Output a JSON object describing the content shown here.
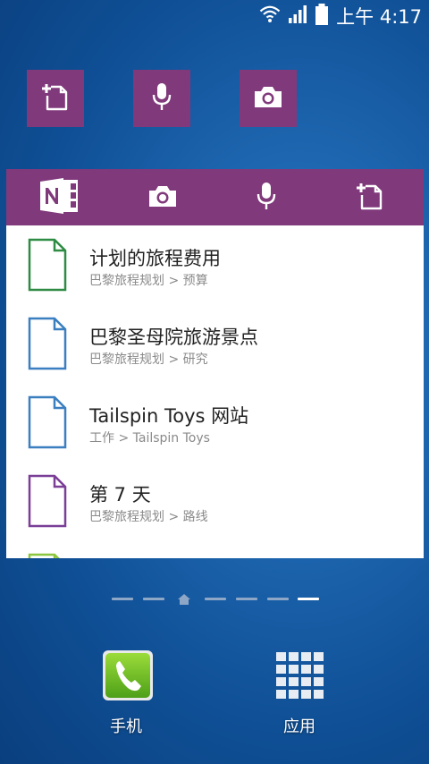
{
  "status": {
    "time": "上午 4:17"
  },
  "home_tiles": [
    {
      "icon": "new-page-icon"
    },
    {
      "icon": "mic-icon"
    },
    {
      "icon": "camera-icon"
    }
  ],
  "widget": {
    "toolbar_icons": [
      "onenote-logo-icon",
      "camera-icon",
      "mic-icon",
      "new-page-icon"
    ],
    "notes": [
      {
        "title": "计划的旅程费用",
        "path": "巴黎旅程规划  > 预算",
        "color": "#2e8b43"
      },
      {
        "title": "巴黎圣母院旅游景点",
        "path": "巴黎旅程规划  > 研究",
        "color": "#3b7fc0"
      },
      {
        "title": "Tailspin Toys 网站",
        "path": "工作 > Tailspin Toys",
        "color": "#3b7fc0"
      },
      {
        "title": "第 7 天",
        "path": "巴黎旅程规划  > 路线",
        "color": "#7a3e97"
      }
    ],
    "partial_note_color": "#8cc63f"
  },
  "pager": {
    "page_count": 7,
    "home_index": 2,
    "active_index": 6
  },
  "dock": {
    "phone_label": "手机",
    "apps_label": "应用"
  }
}
